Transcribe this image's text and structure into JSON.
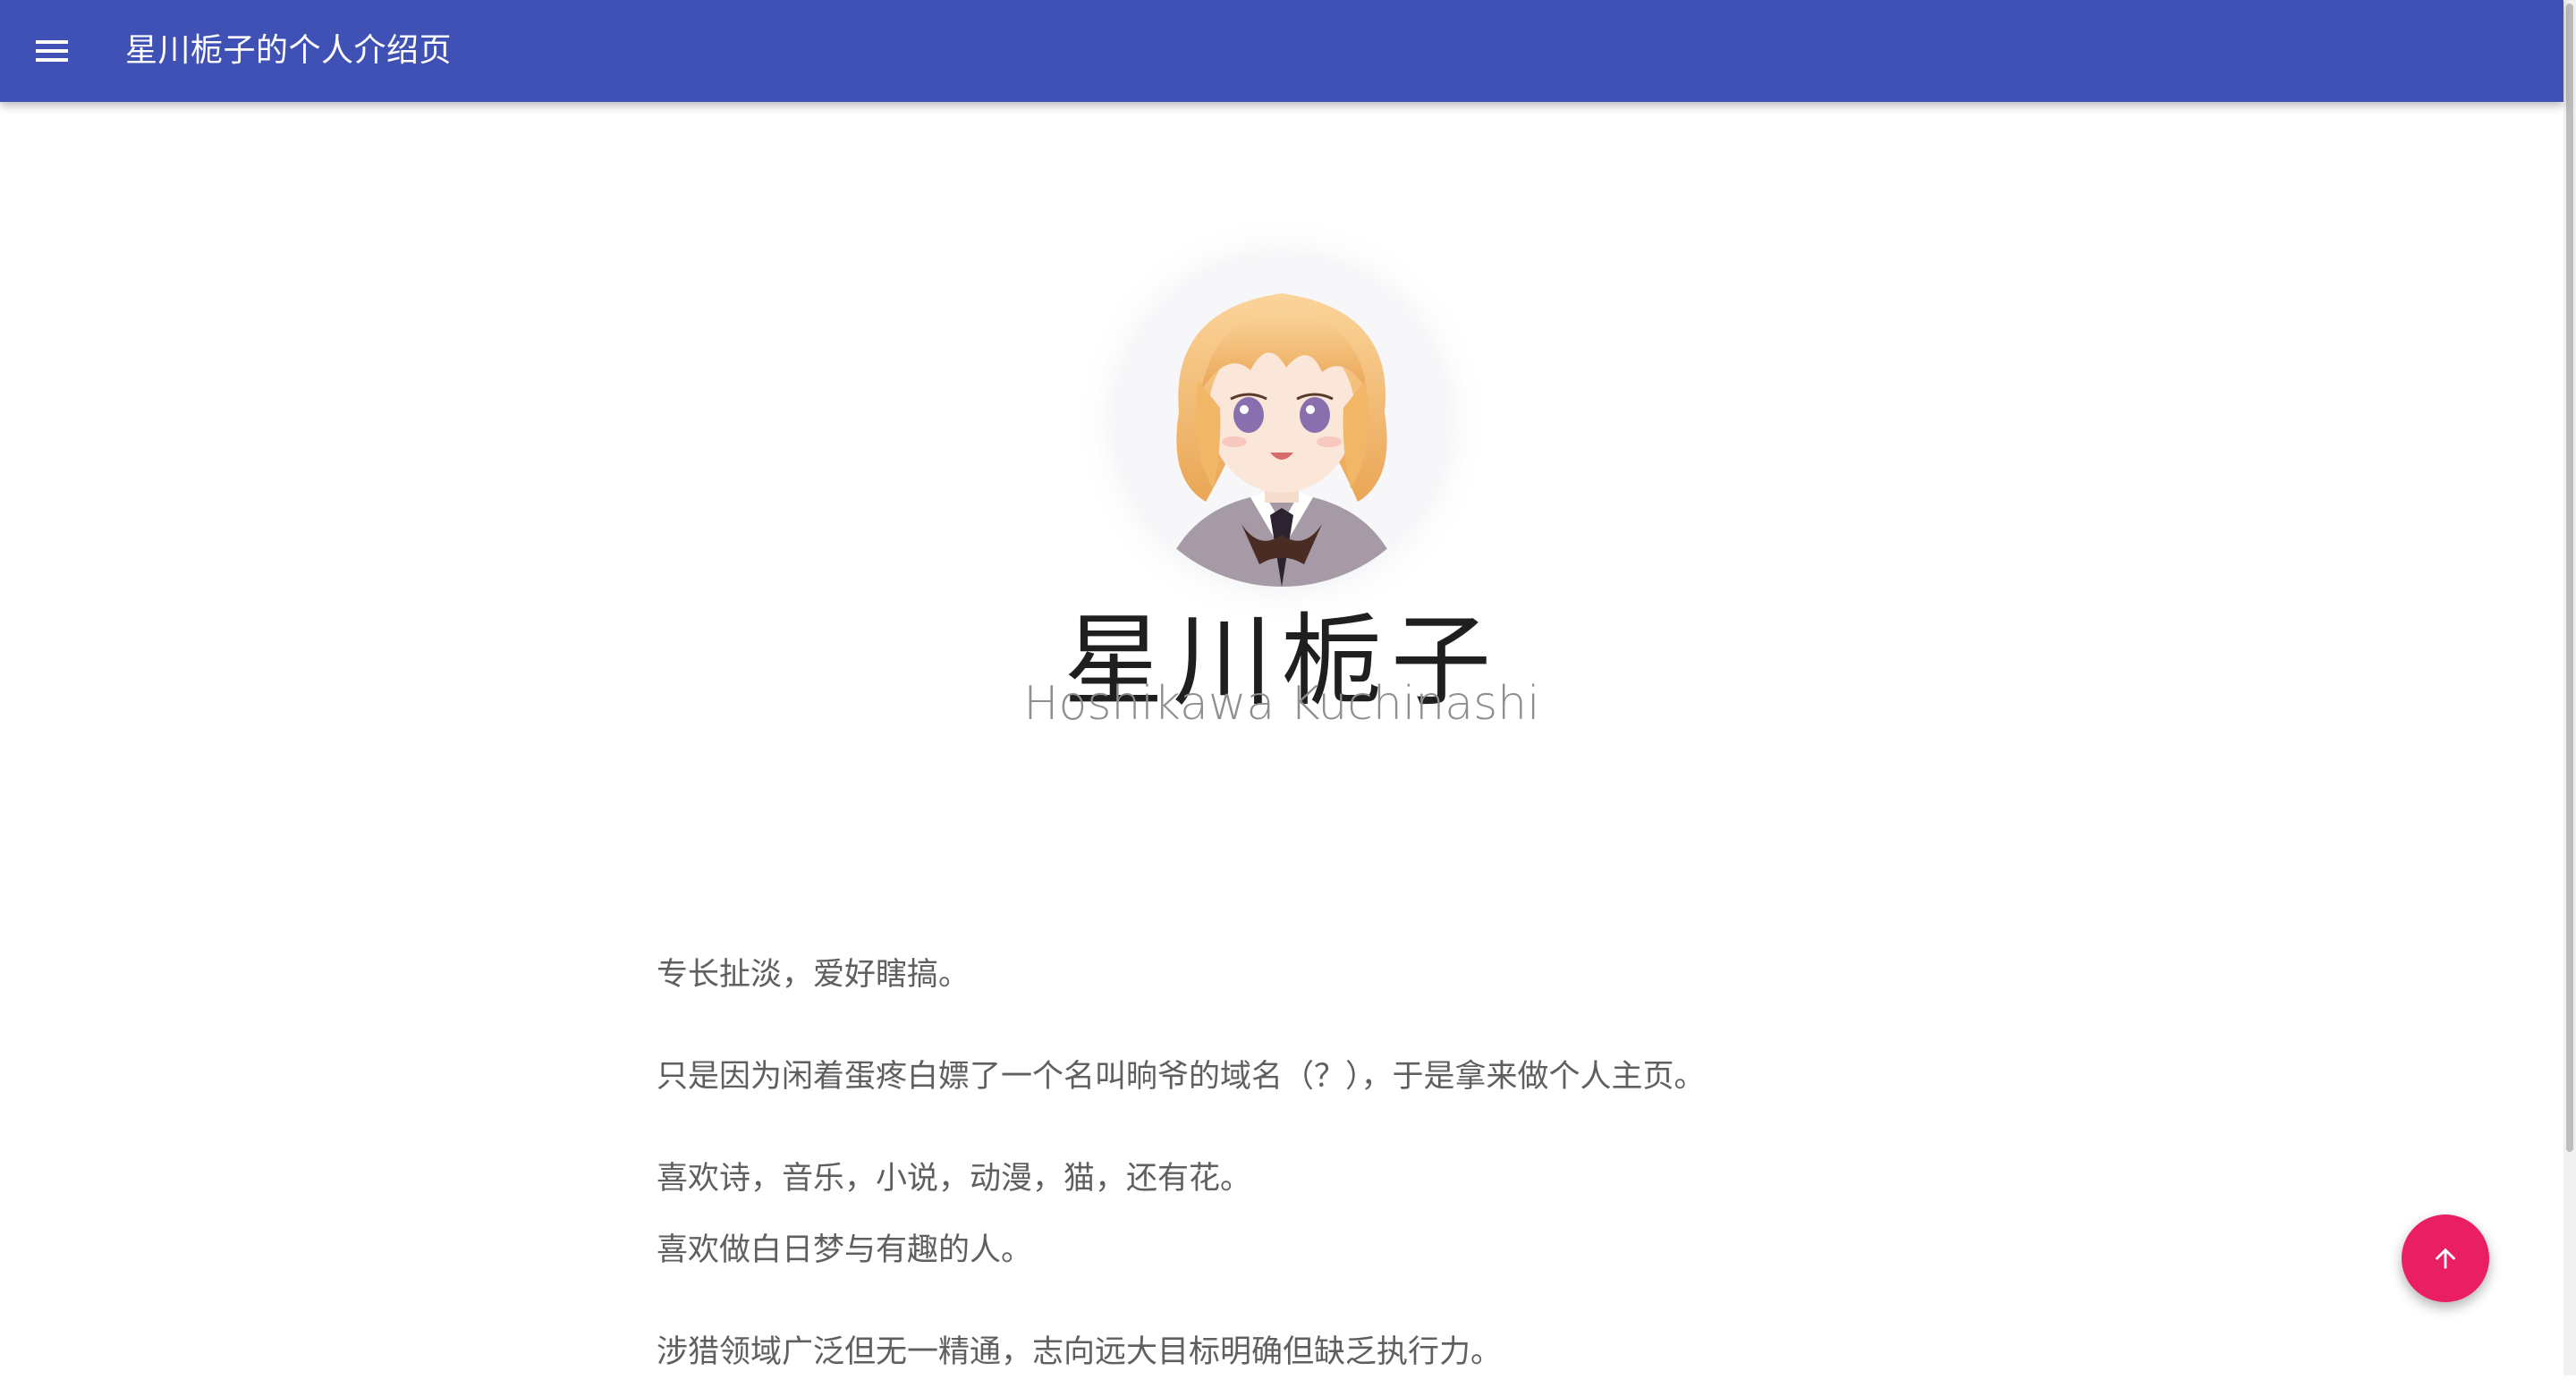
{
  "appbar": {
    "title": "星川栀子的个人介绍页",
    "menu_icon": "menu-icon",
    "color": "#3f51b5"
  },
  "profile": {
    "name_cn": "星川栀子",
    "name_en": "Hoshikawa Kuchinashi",
    "avatar_icon": "anime-girl-avatar"
  },
  "intro": {
    "lines": [
      "专长扯淡，爱好瞎搞。",
      "只是因为闲着蛋疼白嫖了一个名叫晌爷的域名（？），于是拿来做个人主页。",
      "喜欢诗，音乐，小说，动漫，猫，还有花。",
      "喜欢做白日梦与有趣的人。",
      "涉猎领域广泛但无一精通，志向远大目标明确但缺乏执行力。"
    ]
  },
  "fab": {
    "icon": "arrow-up-icon",
    "color": "#e91e63"
  }
}
